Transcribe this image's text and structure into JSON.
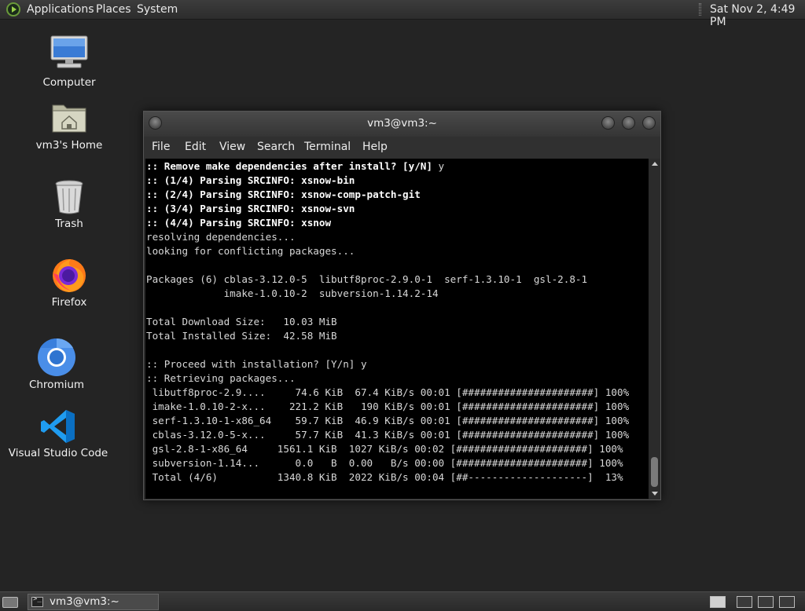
{
  "top_panel": {
    "menus": [
      "Applications",
      "Places",
      "System"
    ],
    "clock": "Sat Nov 2,  4:49 PM"
  },
  "desktop_icons": [
    {
      "label": "Computer",
      "icon": "computer-icon"
    },
    {
      "label": "vm3's Home",
      "icon": "home-folder-icon"
    },
    {
      "label": "Trash",
      "icon": "trash-icon"
    },
    {
      "label": "Firefox",
      "icon": "firefox-icon"
    },
    {
      "label": "Chromium",
      "icon": "chromium-icon"
    },
    {
      "label": "Visual Studio Code",
      "icon": "vscode-icon"
    }
  ],
  "terminal": {
    "title": "vm3@vm3:~",
    "menu": [
      "File",
      "Edit",
      "View",
      "Search",
      "Terminal",
      "Help"
    ],
    "lines": [
      {
        "text": ":: Remove make dependencies after install? [y/N] ",
        "bold": true,
        "tail": "y"
      },
      {
        "text": ":: (1/4) Parsing SRCINFO: xsnow-bin",
        "bold": true
      },
      {
        "text": ":: (2/4) Parsing SRCINFO: xsnow-comp-patch-git",
        "bold": true
      },
      {
        "text": ":: (3/4) Parsing SRCINFO: xsnow-svn",
        "bold": true
      },
      {
        "text": ":: (4/4) Parsing SRCINFO: xsnow",
        "bold": true
      },
      {
        "text": "resolving dependencies..."
      },
      {
        "text": "looking for conflicting packages..."
      },
      {
        "text": ""
      },
      {
        "text": "Packages (6) cblas-3.12.0-5  libutf8proc-2.9.0-1  serf-1.3.10-1  gsl-2.8-1"
      },
      {
        "text": "             imake-1.0.10-2  subversion-1.14.2-14"
      },
      {
        "text": ""
      },
      {
        "text": "Total Download Size:   10.03 MiB"
      },
      {
        "text": "Total Installed Size:  42.58 MiB"
      },
      {
        "text": ""
      },
      {
        "text": ":: Proceed with installation? [Y/n] y"
      },
      {
        "text": ":: Retrieving packages..."
      },
      {
        "text": " libutf8proc-2.9....     74.6 KiB  67.4 KiB/s 00:01 [######################] 100%"
      },
      {
        "text": " imake-1.0.10-2-x...    221.2 KiB   190 KiB/s 00:01 [######################] 100%"
      },
      {
        "text": " serf-1.3.10-1-x86_64    59.7 KiB  46.9 KiB/s 00:01 [######################] 100%"
      },
      {
        "text": " cblas-3.12.0-5-x...     57.7 KiB  41.3 KiB/s 00:01 [######################] 100%"
      },
      {
        "text": " gsl-2.8-1-x86_64     1561.1 KiB  1027 KiB/s 00:02 [######################] 100%"
      },
      {
        "text": " subversion-1.14...      0.0   B  0.00   B/s 00:00 [######################] 100%"
      },
      {
        "text": " Total (4/6)          1340.8 KiB  2022 KiB/s 00:04 [##--------------------]  13%"
      }
    ]
  },
  "bottom_panel": {
    "task_label": "vm3@vm3:~"
  }
}
